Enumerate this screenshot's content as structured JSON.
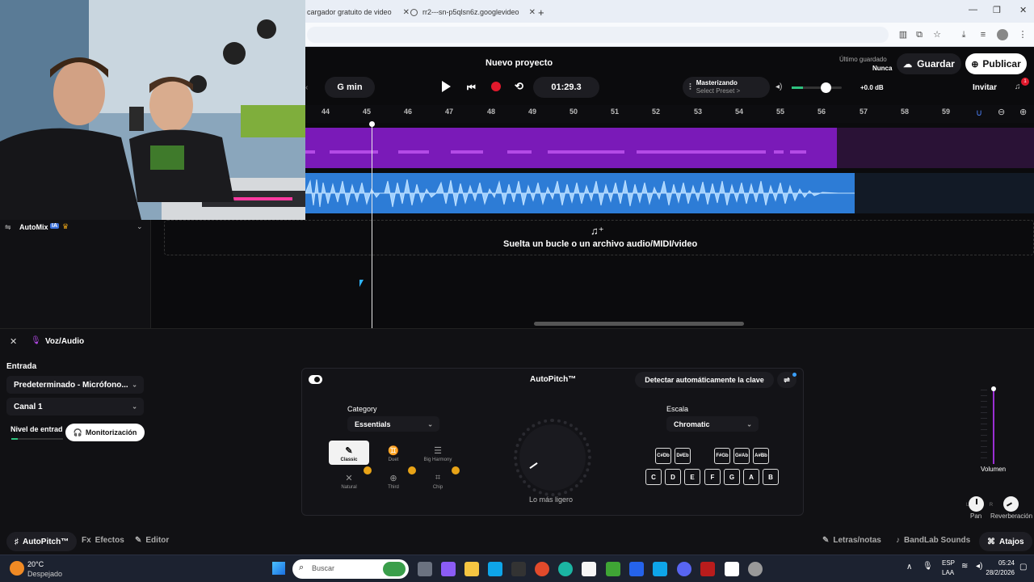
{
  "browser": {
    "tabs": [
      {
        "label": "cargador gratuito de video"
      },
      {
        "label": "rr2---sn-p5qlsn6z.googlevideo"
      }
    ],
    "new_tab": "+"
  },
  "header": {
    "project_title": "Nuevo proyecto",
    "last_saved_label": "Último guardado",
    "last_saved_value": "Nunca",
    "save_label": "Guardar",
    "publish_label": "Publicar",
    "invite_label": "Invitar",
    "notification_count": "1",
    "key_display": "G min",
    "time": "01:29.3",
    "mastering_title": "Masterizando",
    "mastering_preset": "Select Preset >",
    "volume_db": "+0.0 dB"
  },
  "ruler": {
    "marks": [
      "44",
      "45",
      "46",
      "47",
      "48",
      "49",
      "50",
      "51",
      "52",
      "53",
      "54",
      "55",
      "56",
      "57",
      "58",
      "59"
    ]
  },
  "tracks": {
    "drop_text": "Suelta un bucle o un archivo audio/MIDI/video",
    "automix_label": "AutoMix",
    "ia_badge": "IA"
  },
  "panel": {
    "title": "Voz/Audio",
    "input_label": "Entrada",
    "input_device": "Predeterminado - Micrófono...",
    "channel": "Canal 1",
    "input_level_label": "Nivel de entrad",
    "monitoring_label": "Monitorización",
    "autopitch_title": "AutoPitch™",
    "detect_key_label": "Detectar automáticamente la clave",
    "category_label": "Category",
    "category_value": "Essentials",
    "styles": [
      "Classic",
      "Duet",
      "Big Harmony",
      "Natural",
      "Third",
      "Chip"
    ],
    "knob_label": "Lo más ligero",
    "scale_label": "Escala",
    "scale_value": "Chromatic",
    "sharp_keys": [
      [
        "C#",
        "Db"
      ],
      [
        "D#",
        "Eb"
      ],
      [
        "F#",
        "Gb"
      ],
      [
        "G#",
        "Ab"
      ],
      [
        "A#",
        "Bb"
      ]
    ],
    "natural_keys": [
      "C",
      "D",
      "E",
      "F",
      "G",
      "A",
      "B"
    ],
    "volume_label": "Volumen",
    "pan_label": "Pan",
    "reverb_label": "Reverberación",
    "pan_lr": "L R"
  },
  "footer_tabs": {
    "autopitch": "AutoPitch™",
    "effects": "Efectos",
    "editor": "Editor",
    "lyrics": "Letras/notas",
    "sounds": "BandLab Sounds",
    "shortcuts": "Atajos"
  },
  "taskbar": {
    "temperature": "20°C",
    "weather": "Despejado",
    "search_placeholder": "Buscar",
    "lang_1": "ESP",
    "lang_2": "LAA",
    "time": "05:24",
    "date": "28/2/2026"
  },
  "colors": {
    "track_purple": "#7a1ab8",
    "track_blue": "#2d7cd6",
    "record_red": "#e0192c",
    "premium_orange": "#e8a317"
  }
}
